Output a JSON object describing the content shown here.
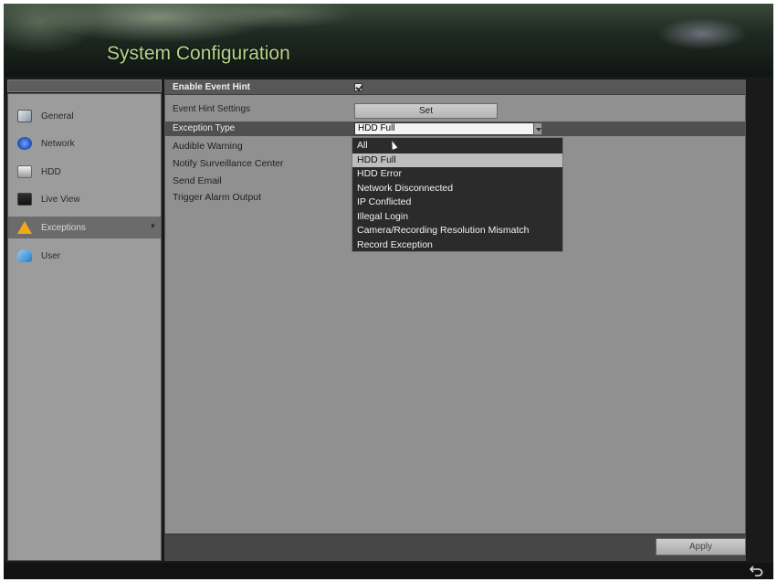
{
  "header": {
    "title": "System Configuration"
  },
  "sidebar": {
    "items": [
      {
        "label": "General",
        "icon": "gear-icon"
      },
      {
        "label": "Network",
        "icon": "network-icon"
      },
      {
        "label": "HDD",
        "icon": "hdd-icon"
      },
      {
        "label": "Live View",
        "icon": "monitor-icon"
      },
      {
        "label": "Exceptions",
        "icon": "warning-icon",
        "active": true
      },
      {
        "label": "User",
        "icon": "user-icon"
      }
    ]
  },
  "main": {
    "enable_event_hint_label": "Enable Event Hint",
    "enable_event_hint_checked": true,
    "event_hint_settings_label": "Event Hint Settings",
    "set_button_label": "Set",
    "exception_type_label": "Exception Type",
    "exception_type_value": "HDD Full",
    "audible_warning_label": "Audible Warning",
    "notify_label": "Notify Surveillance Center",
    "send_email_label": "Send Email",
    "trigger_alarm_label": "Trigger Alarm Output",
    "apply_label": "Apply"
  },
  "dropdown": {
    "options": [
      "All",
      "HDD Full",
      "HDD Error",
      "Network Disconnected",
      "IP Conflicted",
      "Illegal Login",
      "Camera/Recording Resolution Mismatch",
      "Record Exception"
    ],
    "selected_index": 1
  },
  "footer": {
    "back_icon": "back-arrow-icon"
  }
}
